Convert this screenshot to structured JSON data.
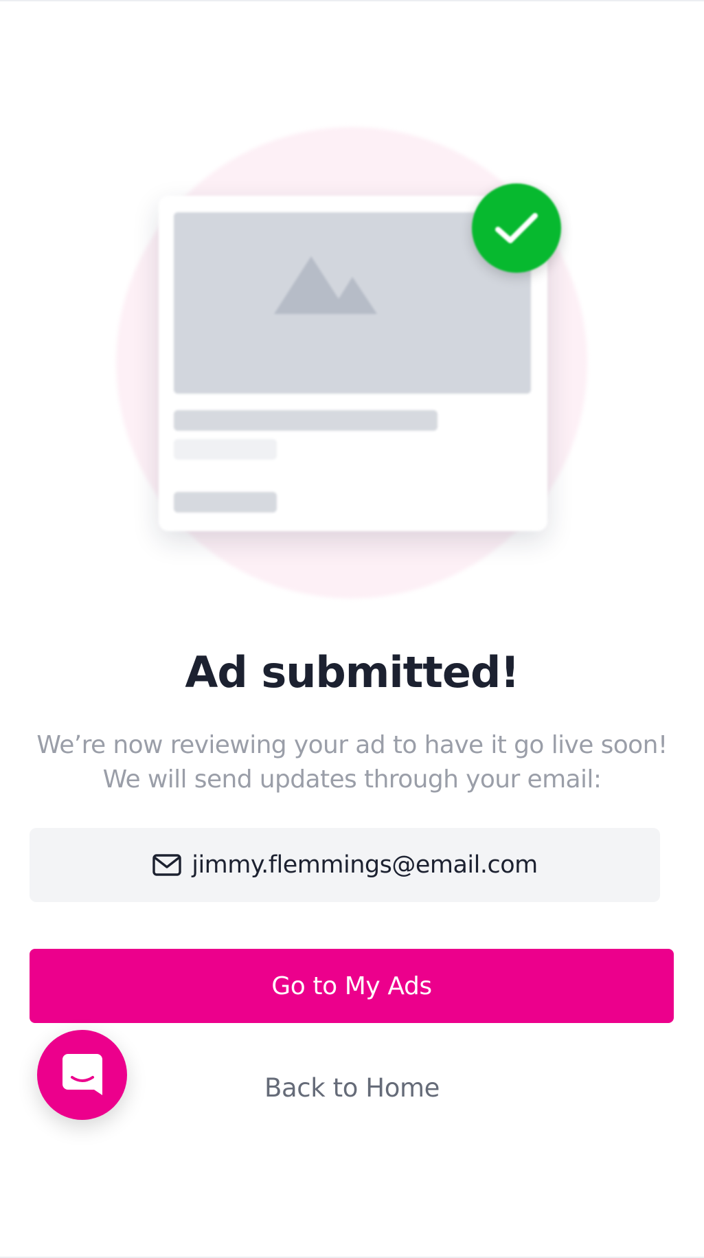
{
  "confirmation": {
    "headline": "Ad submitted!",
    "description": "We’re now reviewing your ad to have it go live soon! We will send updates through your email:",
    "email": "jimmy.flemmings@email.com"
  },
  "actions": {
    "primary_label": "Go to My Ads",
    "secondary_label": "Back to Home"
  },
  "icons": {
    "illustration_placeholder": "image-placeholder-icon",
    "success": "checkmark-icon",
    "email": "mail-icon",
    "chat": "chat-bubble-icon"
  },
  "colors": {
    "brand": "#ec008c",
    "success": "#07b92f",
    "headline": "#1c2130",
    "muted_text": "#9a9ea8",
    "link_text": "#656b78",
    "email_box_bg": "#f3f4f6"
  }
}
